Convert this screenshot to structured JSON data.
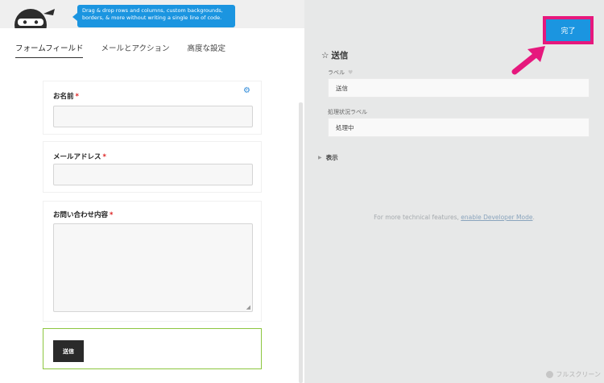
{
  "promo": {
    "line1": "Drag & drop rows and columns, custom backgrounds,",
    "line2": "borders, & more without writing a single line of code."
  },
  "tabs": [
    {
      "label": "フォームフィールド",
      "active": true
    },
    {
      "label": "メールとアクション",
      "active": false
    },
    {
      "label": "高度な設定",
      "active": false
    }
  ],
  "form": {
    "fields": [
      {
        "label": "お名前",
        "required_mark": "*",
        "type": "text"
      },
      {
        "label": "メールアドレス",
        "required_mark": "*",
        "type": "text"
      },
      {
        "label": "お問い合わせ内容",
        "required_mark": "*",
        "type": "textarea"
      }
    ],
    "submit_label": "送信"
  },
  "settings": {
    "done_label": "完了",
    "panel_title": "送信",
    "label_label": "ラベル",
    "label_value": "送信",
    "processing_label": "処理状況ラベル",
    "processing_value": "処理中",
    "display_section": "表示",
    "dev_text": "For more technical features,",
    "dev_link": "enable Developer Mode",
    "dev_period": ".",
    "fullscreen_label": "フルスクリーン"
  },
  "colors": {
    "accent_blue": "#1b95e0",
    "highlight_pink": "#e6187d",
    "selected_border_green": "#8cc63f",
    "required_red": "#dd2222"
  },
  "icons": [
    "ninja-logo-icon",
    "gear-icon",
    "star-outline-icon",
    "heart-icon",
    "caret-right-icon",
    "fullscreen-icon",
    "annotation-arrow-icon"
  ]
}
